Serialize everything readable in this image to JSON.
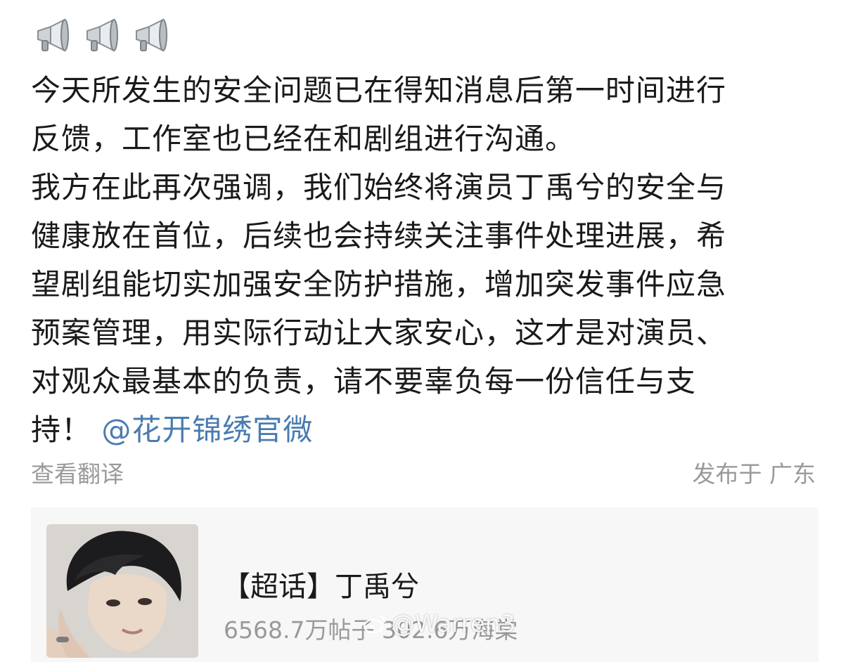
{
  "emojis": [
    {
      "icon": "megaphone-icon"
    },
    {
      "icon": "megaphone-icon"
    },
    {
      "icon": "megaphone-icon"
    }
  ],
  "post": {
    "lines": [
      "今天所发生的安全问题已在得知消息后第一时间进行",
      "反馈，工作室也已经在和剧组进行沟通。",
      "我方在此再次强调，我们始终将演员丁禹兮的安全与",
      "健康放在首位，后续也会持续关注事件处理进展，希",
      "望剧组能切实加强安全防护措施，增加突发事件应急",
      "预案管理，用实际行动让大家安心，这才是对演员、",
      "对观众最基本的负责，请不要辜负每一份信任与支"
    ],
    "last_line_text": "持！",
    "mention": "@花开锦绣官微",
    "mention_color": "#4a7bb0"
  },
  "meta": {
    "translate_label": "查看翻译",
    "location_label": "发布于 广东",
    "text_color": "#9a9a9a"
  },
  "topic_card": {
    "title": "【超话】丁禹兮",
    "stats": "6568.7万帖子 302.6万海棠",
    "background": "#f7f7f7"
  },
  "watermark": {
    "icon": "weibo-logo-icon",
    "text": "@Warren3"
  }
}
